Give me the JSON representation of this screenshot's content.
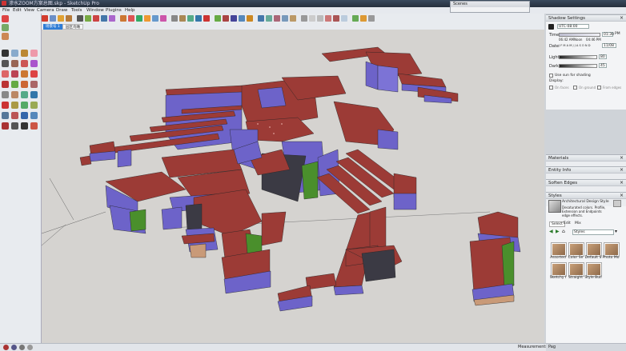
{
  "titlebar": {
    "title": "渗水ZOOM方案总图.skp - SketchUp Pro"
  },
  "menu": {
    "items": [
      "File",
      "Edit",
      "View",
      "Camera",
      "Draw",
      "Tools",
      "Window",
      "Plugins",
      "Help"
    ]
  },
  "tabs": [
    {
      "label": "场景号 1"
    },
    {
      "label": "园区鸟瞰"
    }
  ],
  "scenes_tray": {
    "title": "Scenes"
  },
  "shadow_settings": {
    "title": "Shadow Settings",
    "utc_value": "UTC-08:00",
    "time_label": "Time",
    "time_start": "06:42 AM",
    "time_noon": "Noon",
    "time_end": "04:46 PM",
    "time_value": "01:30",
    "time_suffix": "PM",
    "date_label": "Date",
    "date_months": "J F M A M J J A S O N D",
    "date_value": "11/08",
    "light_label": "Light",
    "light_value": "80",
    "dark_label": "Dark",
    "dark_value": "45",
    "use_sun_label": "Use sun for shading",
    "display_label": "Display:",
    "on_faces": "On faces",
    "on_ground": "On ground",
    "from_edges": "From edges"
  },
  "panels": {
    "materials": "Materials",
    "entity_info": "Entity Info",
    "soften_edges": "Soften Edges",
    "styles": "Styles"
  },
  "styles": {
    "style_name": "Architectural Design Style",
    "style_desc": "Desaturated colors. Profile, Extension and Endpoints edge effects.",
    "tabs": [
      "Select",
      "Edit",
      "Mix"
    ],
    "dropdown": "Styles",
    "thumbnails": [
      "Assorted",
      "Color Se",
      "Default S",
      "Photo Mo",
      "Sketchy I",
      "Straight",
      "Style Buil"
    ]
  },
  "status": {
    "left": "",
    "measurements_label": "Measurements",
    "right": "Pag"
  },
  "colors": {
    "roof": "#9c3b36",
    "wall": "#6d63c9",
    "green": "#4a8f2c",
    "tan": "#c99a78",
    "viewport_bg": "#d5d3d0"
  }
}
